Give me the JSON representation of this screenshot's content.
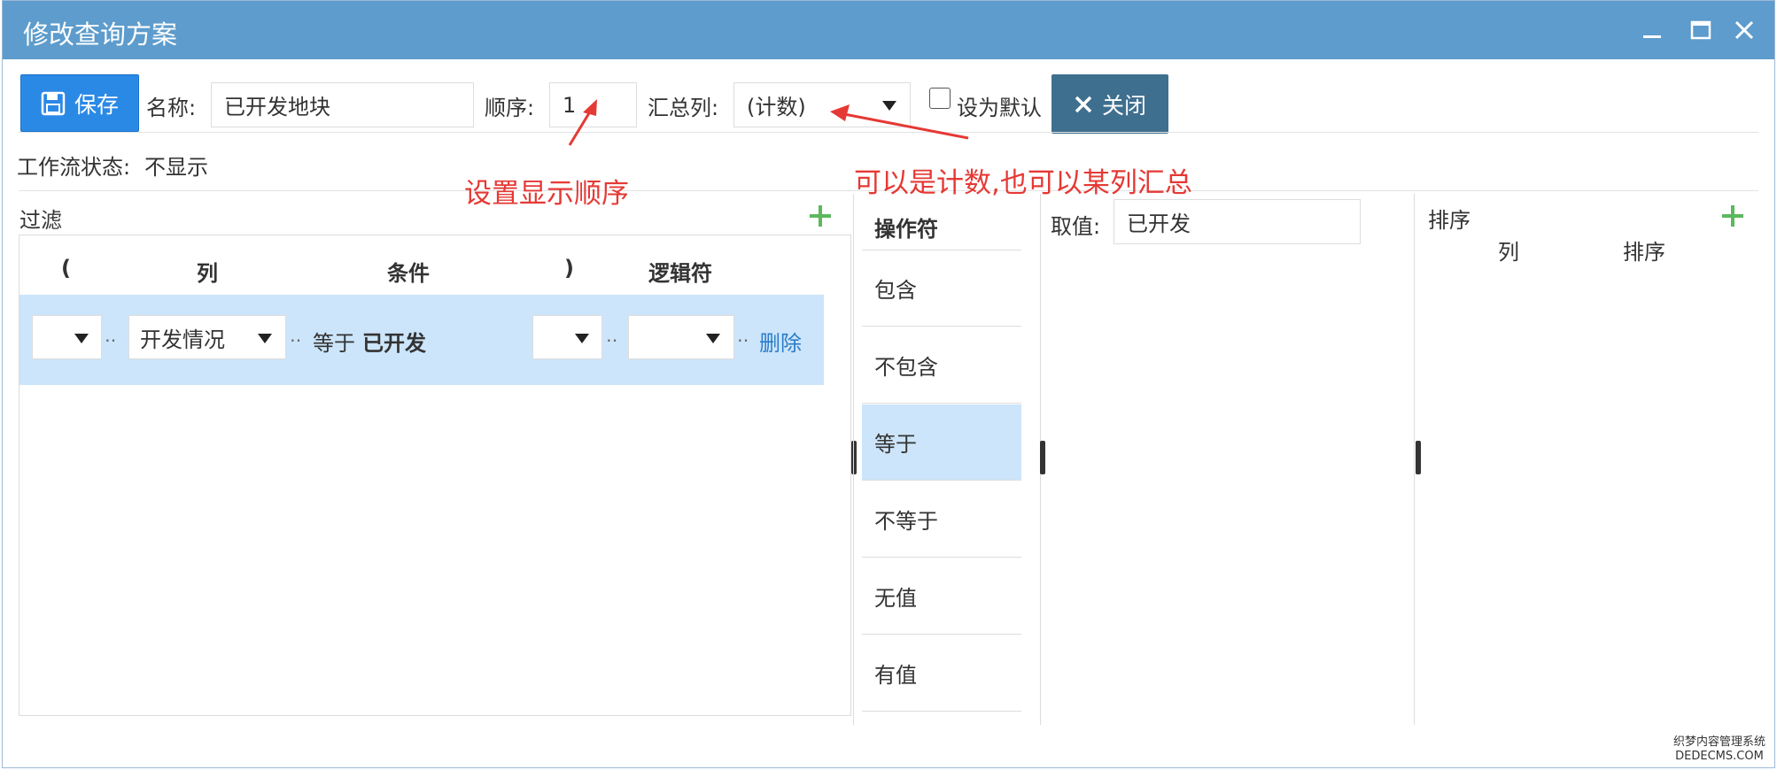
{
  "window": {
    "title": "修改查询方案"
  },
  "toolbar": {
    "save_label": "保存",
    "name_label": "名称:",
    "name_value": "已开发地块",
    "order_label": "顺序:",
    "order_value": "1",
    "summary_label": "汇总列:",
    "summary_value": "(计数)",
    "default_label": "设为默认",
    "close_label": "关闭"
  },
  "workflow": {
    "label": "工作流状态:",
    "value": "不显示"
  },
  "annotations": {
    "order_note": "设置显示顺序",
    "summary_note": "可以是计数,也可以某列汇总"
  },
  "filter": {
    "title": "过滤",
    "columns": [
      "(",
      "列",
      "条件",
      ")",
      "逻辑符"
    ],
    "row": {
      "open_paren": "",
      "column": "开发情况",
      "condition_op": "等于",
      "condition_value": "已开发",
      "close_paren": "",
      "logic": "",
      "delete_label": "删除"
    }
  },
  "operators": {
    "title": "操作符",
    "items": [
      "包含",
      "不包含",
      "等于",
      "不等于",
      "无值",
      "有值"
    ],
    "selected": "等于"
  },
  "value_panel": {
    "label": "取值:",
    "value": "已开发"
  },
  "sort": {
    "title": "排序",
    "columns": [
      "列",
      "排序"
    ]
  },
  "watermark": {
    "line1": "织梦内容管理系统",
    "line2": "DEDECMS.COM"
  },
  "colors": {
    "titlebar": "#5d9ccc",
    "save_button": "#2b89e6",
    "close_button": "#3f6f8e",
    "selected_row": "#cce5fa",
    "annotation": "#e53935",
    "add_icon": "#5cb85c"
  }
}
